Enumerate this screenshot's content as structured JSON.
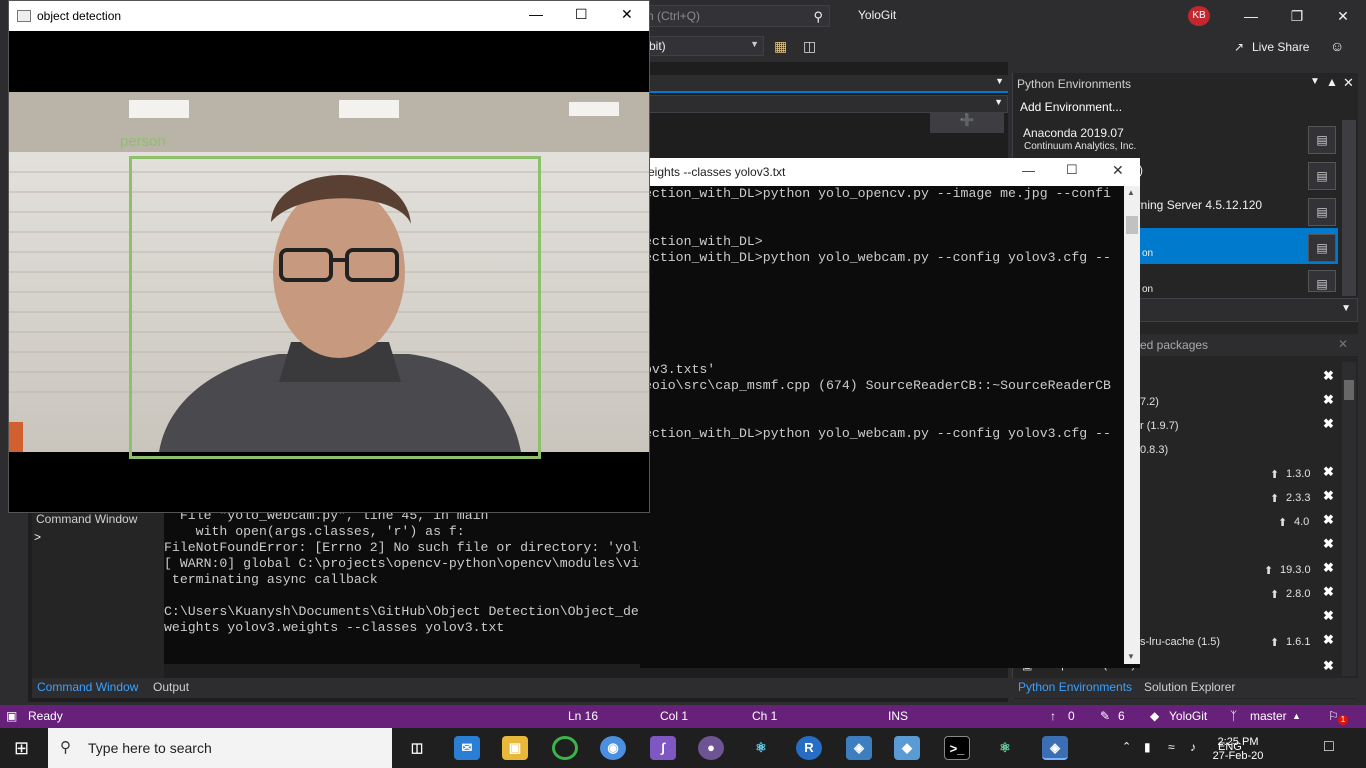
{
  "vs": {
    "search_placeholder": "h (Ctrl+Q)",
    "solution_name": "YoloGit",
    "avatar_initials": "KB",
    "platform": "bit)",
    "live_share": "Live Share"
  },
  "cmd_window": {
    "title": "eights --classes yolov3.txt",
    "lines": [
      "ection_with_DL>python yolo_opencv.py --image me.jpg --confi",
      "",
      "",
      "ection_with_DL>",
      "ection_with_DL>python yolo_webcam.py --config yolov3.cfg --",
      "",
      "",
      "",
      "",
      "",
      "ov3.txts'",
      "eoio\\src\\cap_msmf.cpp (674) SourceReaderCB::~SourceReaderCB",
      "",
      "",
      "",
      "ection_with_DL>python yolo_webcam.py --config yolov3.cfg --"
    ],
    "lower_lines": [
      "  File \"yolo_webcam.py\", line 45, in main",
      "    with open(args.classes, 'r') as f:",
      "FileNotFoundError: [Errno 2] No such file or directory: 'yolov3.txts'",
      "[ WARN:0] global C:\\projects\\opencv-python\\opencv\\modules\\videoio\\src\\cap_msmf.cpp (674) SourceReaderCB::~SourceReaderCB",
      " terminating async callback",
      "",
      "C:\\Users\\Kuanysh\\Documents\\GitHub\\Object Detection\\Object_detection_with_DL>python yolo_webcam.py --config yolov3.cfg --",
      "weights yolov3.weights --classes yolov3.txt"
    ]
  },
  "command_panel": {
    "title": "Command Window",
    "prompt": ">",
    "tab_command": "Command Window",
    "tab_output": "Output"
  },
  "python_env": {
    "title": "Python Environments",
    "add": "Add Environment...",
    "envs": [
      {
        "name": "Anaconda 2019.07",
        "sub": "Continuum Analytics, Inc."
      },
      {
        "name": ")",
        "sub": ""
      },
      {
        "name": "arning Server 4.5.12.120",
        "sub": ""
      },
      {
        "name": "",
        "sub": "on"
      },
      {
        "name": "",
        "sub": "on"
      }
    ],
    "packages_header": "ed packages",
    "packages": [
      {
        "name": "",
        "ver": ""
      },
      {
        "name": "7.2)",
        "ver": ""
      },
      {
        "name": "r (1.9.7)",
        "ver": ""
      },
      {
        "name": "0.8.3)",
        "ver": ""
      },
      {
        "name": "",
        "ver": "1.3.0"
      },
      {
        "name": "",
        "ver": "2.3.3"
      },
      {
        "name": "",
        "ver": "4.0"
      },
      {
        "name": "",
        "ver": ""
      },
      {
        "name": "",
        "ver": "19.3.0"
      },
      {
        "name": "",
        "ver": "2.8.0"
      },
      {
        "name": "",
        "ver": ""
      },
      {
        "name": "s-lru-cache (1.5)",
        "ver": "1.6.1"
      },
      {
        "name": "backports.os (0.1.1)",
        "ver": ""
      }
    ],
    "tab_envs": "Python Environments",
    "tab_solution": "Solution Explorer"
  },
  "statusbar": {
    "ready": "Ready",
    "ln": "Ln 16",
    "col": "Col 1",
    "ch": "Ch 1",
    "ins": "INS",
    "up": "0",
    "edits": "6",
    "repo": "YoloGit",
    "branch": "master",
    "notif": "1"
  },
  "taskbar": {
    "search": "Type here to search",
    "lang": "ENG",
    "time": "2:25 PM",
    "date": "27-Feb-20"
  },
  "od_window": {
    "title": "object detection",
    "label": "person",
    "box_color": "#8ec06c"
  }
}
